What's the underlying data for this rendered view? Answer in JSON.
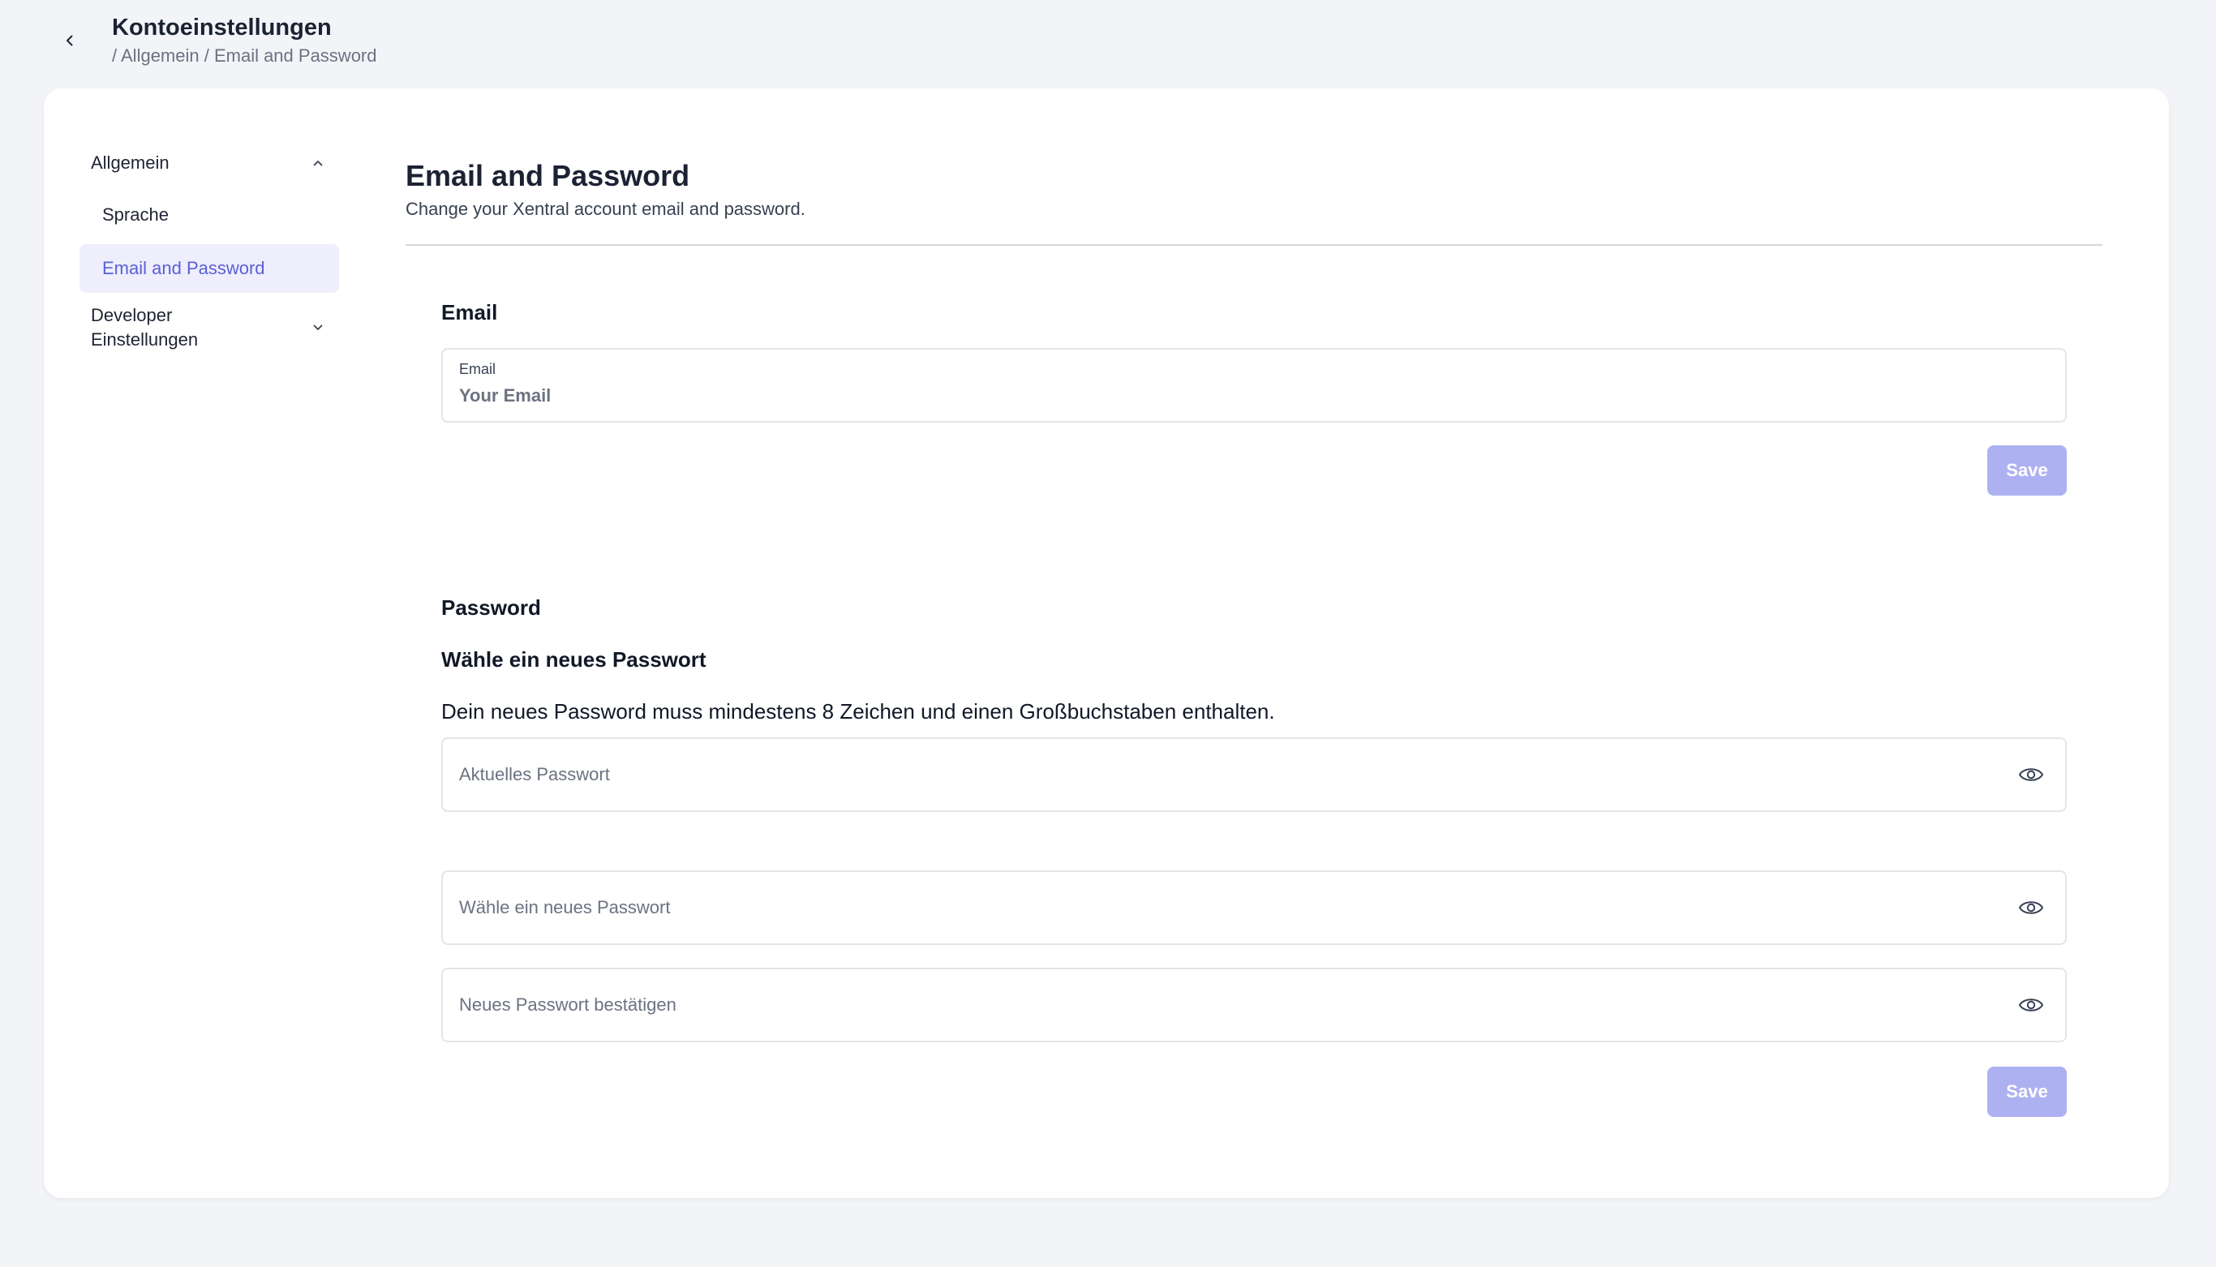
{
  "header": {
    "title": "Kontoeinstellungen",
    "breadcrumb": "/ Allgemein / Email and Password"
  },
  "sidebar": {
    "groups": [
      {
        "label": "Allgemein",
        "expanded": true,
        "items": [
          {
            "label": "Sprache",
            "active": false
          },
          {
            "label": "Email and Password",
            "active": true
          }
        ]
      },
      {
        "label": "Developer Einstellungen",
        "expanded": false
      }
    ]
  },
  "main": {
    "title": "Email and Password",
    "subtitle": "Change your Xentral account email and password.",
    "email_section": {
      "heading": "Email",
      "field_label": "Email",
      "field_value": "Your Email",
      "save_label": "Save"
    },
    "password_section": {
      "heading": "Password",
      "subheading": "Wähle ein neues Passwort",
      "hint": "Dein neues Password muss mindestens 8 Zeichen und einen Großbuchstaben enthalten.",
      "fields": [
        {
          "placeholder": "Aktuelles Passwort"
        },
        {
          "placeholder": "Wähle ein neues Passwort"
        },
        {
          "placeholder": "Neues Passwort bestätigen"
        }
      ],
      "save_label": "Save"
    }
  },
  "colors": {
    "accent": "#5b5fd6",
    "active_bg": "#eeeefc",
    "button_disabled": "#aeb1f1",
    "page_bg": "#f3f4f8"
  },
  "icons": {
    "back": "chevron-left-icon",
    "expand_open": "chevron-up-icon",
    "expand_closed": "chevron-down-icon",
    "visibility": "eye-icon"
  }
}
